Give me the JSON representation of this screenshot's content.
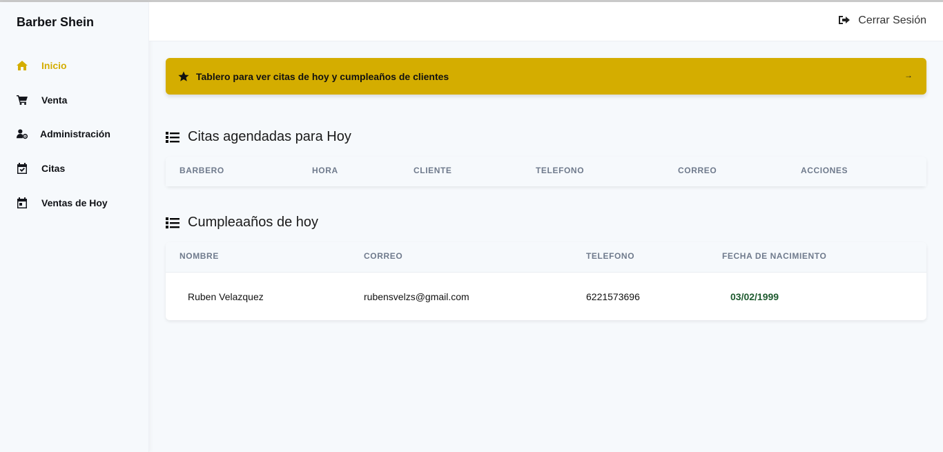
{
  "sidebar": {
    "brand": "Barber Shein",
    "items": [
      {
        "label": "Inicio",
        "icon": "home-icon",
        "active": true
      },
      {
        "label": "Venta",
        "icon": "cart-icon"
      },
      {
        "label": "Administración",
        "icon": "user-gear-icon"
      },
      {
        "label": "Citas",
        "icon": "calendar-check-icon"
      },
      {
        "label": "Ventas de Hoy",
        "icon": "calendar-day-icon"
      }
    ]
  },
  "header": {
    "logout_label": "Cerrar Sesión",
    "logout_icon": "sign-out-icon"
  },
  "banner": {
    "text": "Tablero para ver citas de hoy y cumpleaños de clientes",
    "arrow": "→",
    "color": "#d4ad00"
  },
  "citas": {
    "title": "Citas agendadas para Hoy",
    "columns": [
      "BARBERO",
      "HORA",
      "CLIENTE",
      "TELEFONO",
      "CORREO",
      "ACCIONES"
    ],
    "rows": []
  },
  "cumpleanos": {
    "title": "Cumpleaaños de hoy",
    "columns": [
      "NOMBRE",
      "CORREO",
      "TELEFONO",
      "FECHA DE NACIMIENTO"
    ],
    "rows": [
      {
        "nombre": "Ruben Velazquez",
        "correo": "rubensvelzs@gmail.com",
        "telefono": "6221573696",
        "fecha": "03/02/1999"
      }
    ]
  },
  "colors": {
    "accent": "#d4ad00",
    "date_text": "#1d5a2e",
    "header_text": "#6f7a8c"
  }
}
